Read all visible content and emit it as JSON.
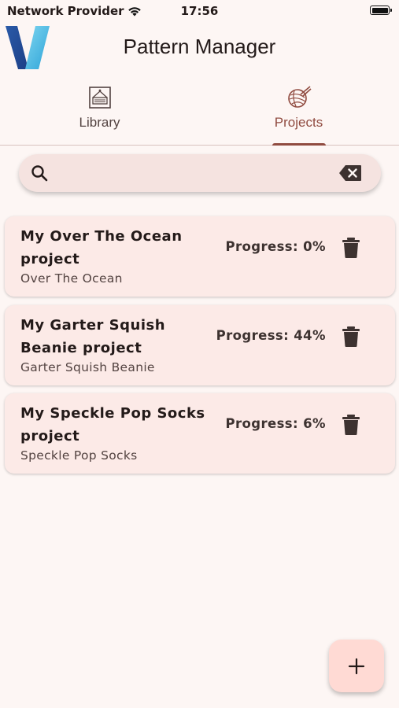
{
  "status_bar": {
    "carrier": "Network Provider",
    "time": "17:56"
  },
  "app_bar": {
    "title": "Pattern Manager"
  },
  "tabs": [
    {
      "label": "Library",
      "icon": "knitting-frame-icon",
      "selected": false
    },
    {
      "label": "Projects",
      "icon": "yarn-ball-icon",
      "selected": true
    }
  ],
  "search": {
    "value": "",
    "placeholder": ""
  },
  "projects": [
    {
      "name": "My Over The Ocean project",
      "pattern": "Over The Ocean",
      "progress_label": "Progress: 0%",
      "progress": 0
    },
    {
      "name": "My Garter Squish Beanie project",
      "pattern": "Garter Squish Beanie",
      "progress_label": "Progress: 44%",
      "progress": 44
    },
    {
      "name": "My Speckle Pop Socks project",
      "pattern": "Speckle Pop Socks",
      "progress_label": "Progress: 6%",
      "progress": 6
    }
  ],
  "fab": {
    "icon": "plus-icon"
  },
  "colors": {
    "background": "#fdf6f4",
    "accent": "#904b40",
    "card": "#fceae7",
    "search_bg": "#f5e3e0",
    "fab_bg": "#ffdad4"
  }
}
